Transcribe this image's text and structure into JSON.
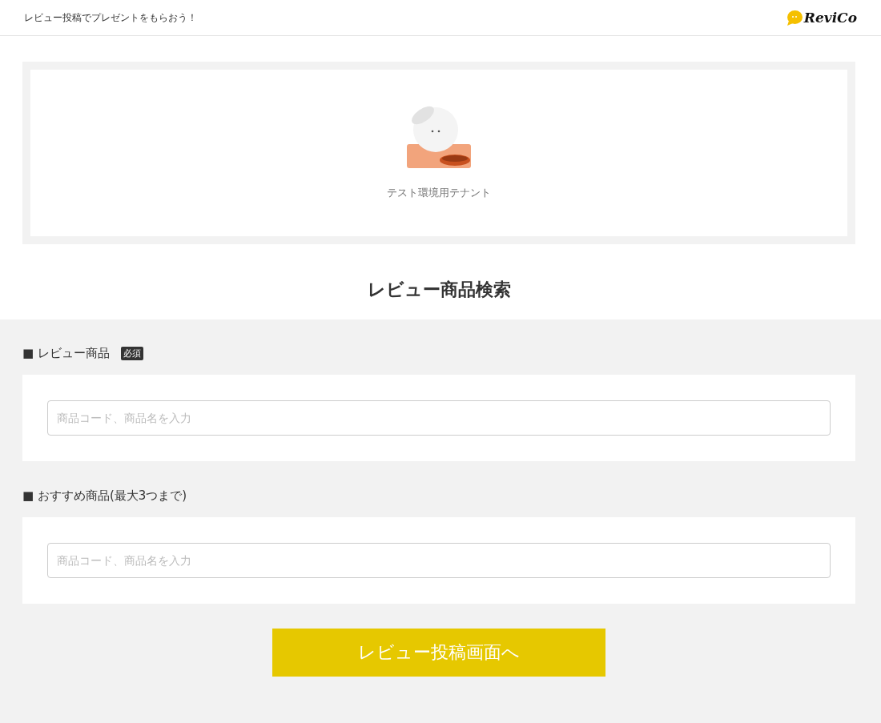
{
  "header": {
    "tagline": "レビュー投稿でプレゼントをもらおう！",
    "logo": "ReviCo"
  },
  "shop": {
    "name": "テスト環境用テナント"
  },
  "title": "レビュー商品検索",
  "fields": [
    {
      "label": "■ レビュー商品",
      "badge": "必須",
      "placeholder": "商品コード、商品名を入力"
    },
    {
      "label": "■ おすすめ商品(最大3つまで)",
      "placeholder": "商品コード、商品名を入力"
    }
  ],
  "submit": "レビュー投稿画面へ"
}
